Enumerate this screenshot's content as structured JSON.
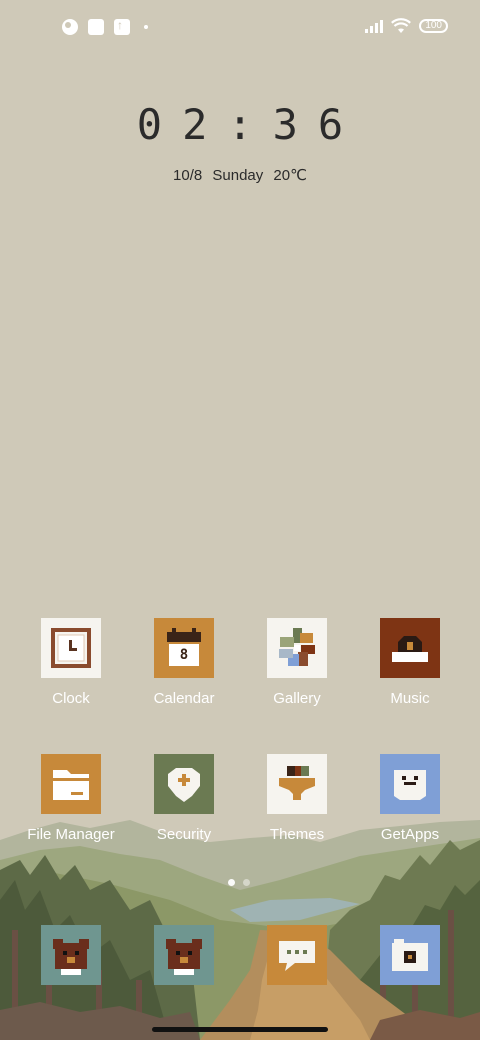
{
  "status_bar": {
    "battery": "100",
    "left_icons": [
      "notification-icon",
      "square-icon",
      "upload-icon",
      "dot-icon"
    ],
    "right_icons": [
      "signal-icon",
      "wifi-icon",
      "battery-icon"
    ]
  },
  "widget": {
    "time": "02:36",
    "date": "10/8 Sunday 20℃"
  },
  "apps": [
    {
      "label": "Clock"
    },
    {
      "label": "Calendar",
      "tile_text": "8"
    },
    {
      "label": "Gallery"
    },
    {
      "label": "Music"
    },
    {
      "label": "File Manager"
    },
    {
      "label": "Security"
    },
    {
      "label": "Themes"
    },
    {
      "label": "GetApps"
    }
  ],
  "dock": [
    {
      "icon": "bear-icon"
    },
    {
      "icon": "bear-icon"
    },
    {
      "icon": "messages-icon"
    },
    {
      "icon": "camera-icon"
    }
  ],
  "pager": {
    "pages": 2,
    "current": 1
  },
  "colors": {
    "wallpaper": "#cfc9b8",
    "orange": "#c7893a",
    "brown": "#7e3414",
    "green": "#6b7a52",
    "blue": "#7f9fd6",
    "teal": "#6f9690"
  }
}
